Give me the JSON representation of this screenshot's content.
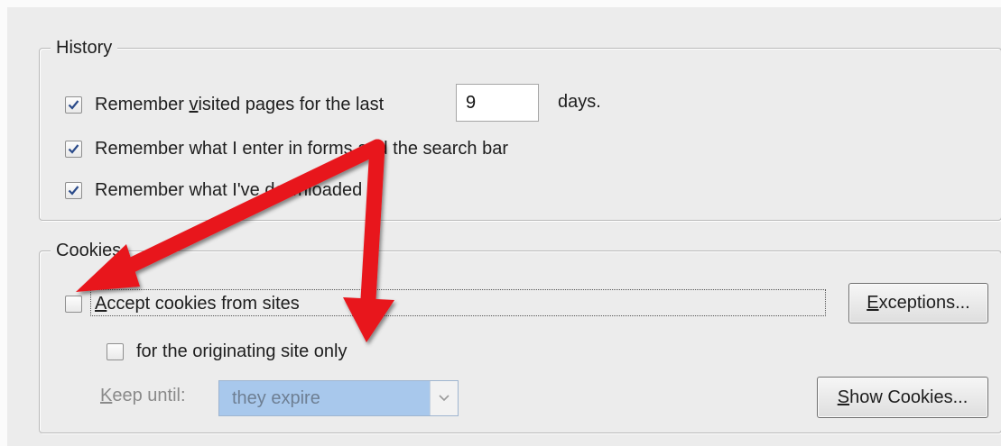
{
  "history": {
    "legend": "History",
    "items": [
      {
        "label_pre": "Remember ",
        "label_ul": "v",
        "label_post": "isited pages for the last",
        "checked": true
      },
      {
        "label": "Remember what I enter in forms and the search bar",
        "checked": true
      },
      {
        "label": "Remember what I've downloaded",
        "checked": true
      }
    ],
    "days_value": "9",
    "days_suffix": "days."
  },
  "cookies": {
    "legend": "Cookies",
    "accept": {
      "label_ul": "A",
      "label_post": "ccept cookies from sites",
      "checked": false
    },
    "originating": {
      "label": "for the originating site only",
      "checked": false
    },
    "keep_until_ul": "K",
    "keep_until_post": "eep until:",
    "keep_until_value": "they expire",
    "exceptions_ul": "E",
    "exceptions_post": "xceptions...",
    "show_ul": "S",
    "show_post": "how Cookies..."
  },
  "colors": {
    "arrow": "#e8141c",
    "selection": "#a8c8ec"
  },
  "icons": {
    "check": "checkmark-icon",
    "dropdown": "chevron-down-icon"
  }
}
